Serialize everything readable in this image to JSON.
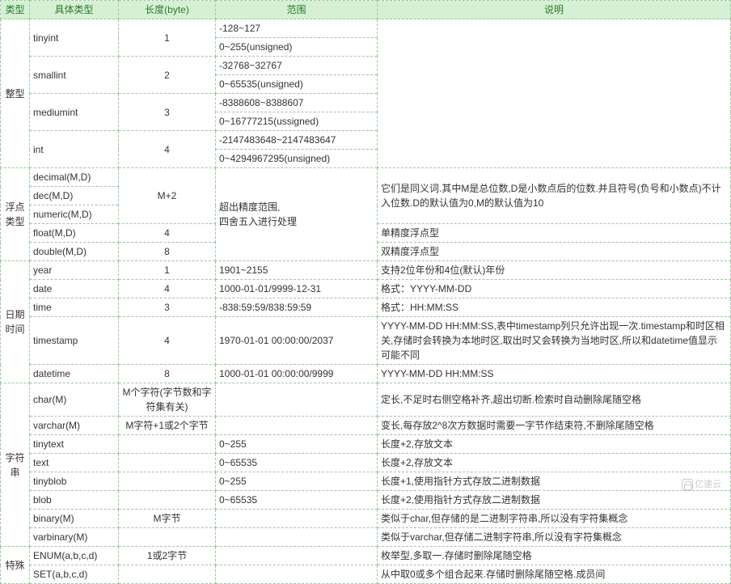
{
  "headers": [
    "类型",
    "具体类型",
    "长度(byte)",
    "范围",
    "说明"
  ],
  "watermark": "亿速云",
  "groups": [
    {
      "cat": "整型",
      "rows": [
        {
          "name": "tinyint",
          "len": "1",
          "range": [
            "-128~127",
            "0~255(unsigned)"
          ],
          "desc": ""
        },
        {
          "name": "smallint",
          "len": "2",
          "range": [
            "-32768~32767",
            "0~65535(unsigned)"
          ],
          "desc": ""
        },
        {
          "name": "mediumint",
          "len": "3",
          "range": [
            "-8388608~8388607",
            "0~16777215(ussigned)"
          ],
          "desc": ""
        },
        {
          "name": "int",
          "len": "4",
          "range": [
            "-2147483648~2147483647",
            "0~4294967295(unsigned)"
          ],
          "desc": ""
        }
      ],
      "groupDesc": ""
    },
    {
      "cat": "浮点类型",
      "rows": [
        {
          "name": "decimal(M,D)",
          "len": "M+2",
          "range": "超出精度范围,\n四舍五入进行处理",
          "desc": "它们是同义词.其中M是总位数,D是小数点后的位数.并且符号(负号和小数点)不计入位数.D的默认值为0,M的默认值为10",
          "merge": 3
        },
        {
          "name": "dec(M,D)",
          "len": "",
          "range": "",
          "desc": ""
        },
        {
          "name": "numeric(M,D)",
          "len": "",
          "range": "",
          "desc": ""
        },
        {
          "name": "float(M,D)",
          "len": "4",
          "range": "",
          "desc": "单精度浮点型"
        },
        {
          "name": "double(M,D)",
          "len": "8",
          "range": "",
          "desc": "双精度浮点型"
        }
      ]
    },
    {
      "cat": "日期时间",
      "rows": [
        {
          "name": "year",
          "len": "1",
          "range": "1901~2155",
          "desc": "支持2位年份和4位(默认)年份"
        },
        {
          "name": "date",
          "len": "4",
          "range": "1000-01-01/9999-12-31",
          "desc": "格式：YYYY-MM-DD"
        },
        {
          "name": "time",
          "len": "3",
          "range": "-838:59:59/838:59:59",
          "desc": "格式：HH:MM:SS"
        },
        {
          "name": "timestamp",
          "len": "4",
          "range": "1970-01-01 00:00:00/2037",
          "desc": "YYYY-MM-DD HH:MM:SS,表中timestamp列只允许出现一次.timestamp和时区相关,存储时会转换为本地时区,取出时又会转换为当地时区,所以和datetime值显示可能不同"
        },
        {
          "name": "datetime",
          "len": "8",
          "range": "1000-01-01 00:00:00/9999",
          "desc": "YYYY-MM-DD HH:MM:SS"
        }
      ]
    },
    {
      "cat": "字符串",
      "rows": [
        {
          "name": "char(M)",
          "len": "M个字符(字节数和字符集有关)",
          "range": "",
          "desc": "定长,不足时右侧空格补齐,超出切断.检索时自动删除尾随空格"
        },
        {
          "name": "varchar(M)",
          "len": "M字符+1或2个字节",
          "range": "",
          "desc": "变长,每存放2^8次方数据时需要一字节作结束符,不删除尾随空格"
        },
        {
          "name": "tinytext",
          "len": "",
          "range": "0~255",
          "desc": "长度+2,存放文本"
        },
        {
          "name": "text",
          "len": "",
          "range": "0~65535",
          "desc": "长度+2,存放文本"
        },
        {
          "name": "tinyblob",
          "len": "",
          "range": "0~255",
          "desc": "长度+1,使用指针方式存放二进制数据"
        },
        {
          "name": "blob",
          "len": "",
          "range": "0~65535",
          "desc": "长度+2,使用指针方式存放二进制数据"
        },
        {
          "name": "binary(M)",
          "len": "M字节",
          "range": "",
          "desc": "类似于char,但存储的是二进制字符串,所以没有字符集概念"
        },
        {
          "name": "varbinary(M)",
          "len": "",
          "range": "",
          "desc": "类似于varchar,但存储二进制字符串,所以没有字符集概念"
        }
      ]
    },
    {
      "cat": "特殊",
      "rows": [
        {
          "name": "ENUM(a,b,c,d)",
          "len": "1或2字节",
          "range": "",
          "desc": "枚举型,多取一.存储时删除尾随空格"
        },
        {
          "name": "SET(a,b,c,d)",
          "len": "",
          "range": "",
          "desc": "从中取0或多个组合起来.存储时删除尾随空格.成员间"
        }
      ]
    }
  ]
}
